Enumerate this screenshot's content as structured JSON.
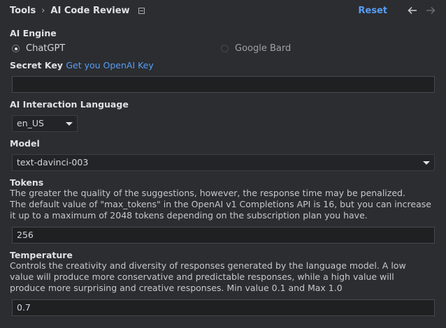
{
  "header": {
    "breadcrumb_root": "Tools",
    "breadcrumb_separator": "›",
    "breadcrumb_current": "AI Code Review",
    "reset_label": "Reset"
  },
  "engine": {
    "label": "AI Engine",
    "options": [
      "ChatGPT",
      "Google Bard"
    ],
    "selected": "ChatGPT"
  },
  "secret_key": {
    "label": "Secret Key",
    "link_text": "Get you OpenAI Key",
    "value": ""
  },
  "language": {
    "label": "AI Interaction Language",
    "selected": "en_US"
  },
  "model": {
    "label": "Model",
    "selected": "text-davinci-003"
  },
  "tokens": {
    "label": "Tokens",
    "description_lines": [
      "The greater the quality of the suggestions, however, the response time may be penalized.",
      "The default value of \"max_tokens\" in the OpenAI v1 Completions API is 16, but you can increase",
      "it up to a maximum of 2048 tokens depending on the subscription plan you have."
    ],
    "value": "256"
  },
  "temperature": {
    "label": "Temperature",
    "description_lines": [
      "Controls the creativity and diversity of responses generated by the language model. A low",
      "value will produce more conservative and predictable responses, while a high value will",
      "produce more surprising and creative responses. Min value 0.1 and Max 1.0"
    ],
    "value": "0.7"
  },
  "icons": {
    "back": "arrow-left-icon",
    "forward": "arrow-right-icon",
    "doc": "document-icon"
  },
  "colors": {
    "background": "#2b2d30",
    "link": "#589df6",
    "input_background": "#1f2022"
  }
}
